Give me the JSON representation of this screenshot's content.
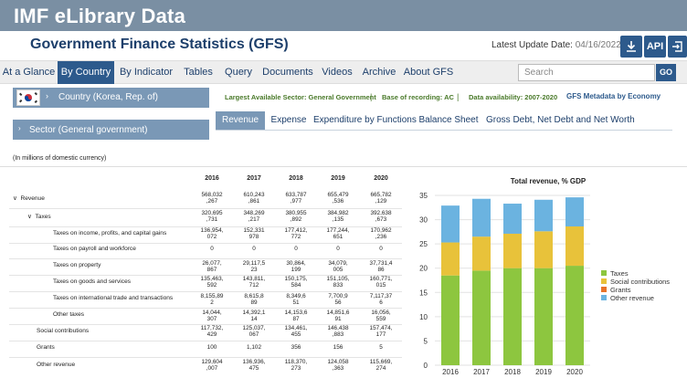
{
  "app": {
    "title": "IMF eLibrary Data"
  },
  "header": {
    "page_title": "Government Finance Statistics (GFS)",
    "update_label": "Latest Update Date:",
    "update_date": "04/16/2022",
    "api_label": "API",
    "download_icon": "download-icon",
    "share_icon": "share-icon"
  },
  "nav": {
    "items": [
      "At a Glance",
      "By Country",
      "By Indicator",
      "Tables",
      "Query",
      "Documents",
      "Videos",
      "Archive",
      "About GFS"
    ],
    "active": "By Country",
    "search_placeholder": "Search",
    "go_label": "GO"
  },
  "country": {
    "label": "Country (Korea, Rep. of)",
    "flag_icon": "south-korea-flag-icon"
  },
  "info": {
    "largest_sector": "Largest Available Sector: General Government",
    "recording_basis": "Base of recording: AC",
    "availability": "Data availability: 2007-2020",
    "metadata_link": "GFS Metadata by Economy"
  },
  "sector": {
    "label": "Sector (General government)"
  },
  "subtabs": {
    "items": [
      "Revenue",
      "Expense",
      "Expenditure by Functions",
      "Balance Sheet",
      "Gross Debt, Net Debt and Net Worth"
    ],
    "active": "Revenue"
  },
  "units_note": "(In millions of domestic currency)",
  "table": {
    "years": [
      "2016",
      "2017",
      "2018",
      "2019",
      "2020"
    ],
    "rows": [
      {
        "label": "Revenue",
        "values": [
          [
            "568,032",
            ",267"
          ],
          [
            "610,243",
            ",861"
          ],
          [
            "633,787",
            ",977"
          ],
          [
            "655,479",
            ",536"
          ],
          [
            "665,782",
            ",129"
          ]
        ]
      },
      {
        "label": "Taxes",
        "values": [
          [
            "320,695",
            ",731"
          ],
          [
            "348,269",
            ",217"
          ],
          [
            "380,955",
            ",892"
          ],
          [
            "384,982",
            ",135"
          ],
          [
            "392,638",
            ",673"
          ]
        ]
      },
      {
        "label": "Taxes on income, profits, and capital gains",
        "values": [
          [
            "136,954,",
            "072"
          ],
          [
            "152,331",
            "978"
          ],
          [
            "177,412,",
            "772"
          ],
          [
            "177,244,",
            "651"
          ],
          [
            "170,962",
            ",236"
          ]
        ]
      },
      {
        "label": "Taxes on payroll and workforce",
        "values": [
          [
            "0",
            ""
          ],
          [
            "0",
            ""
          ],
          [
            "0",
            ""
          ],
          [
            "0",
            ""
          ],
          [
            "0",
            ""
          ]
        ]
      },
      {
        "label": "Taxes on property",
        "values": [
          [
            "26,077,",
            "867"
          ],
          [
            "29,117,5",
            "23"
          ],
          [
            "30,864,",
            "199"
          ],
          [
            "34,079,",
            "005"
          ],
          [
            "37,731,4",
            "86"
          ]
        ]
      },
      {
        "label": "Taxes on goods and services",
        "values": [
          [
            "135,463,",
            "592"
          ],
          [
            "143,811,",
            "712"
          ],
          [
            "150,175,",
            "584"
          ],
          [
            "151,105,",
            "833"
          ],
          [
            "160,771,",
            "015"
          ]
        ]
      },
      {
        "label": "Taxes on international trade and transactions",
        "values": [
          [
            "8,155,89",
            "2"
          ],
          [
            "8,615,8",
            "89"
          ],
          [
            "8,349,6",
            "51"
          ],
          [
            "7,700,9",
            "56"
          ],
          [
            "7,117,37",
            "6"
          ]
        ]
      },
      {
        "label": "Other taxes",
        "values": [
          [
            "14,044,",
            "307"
          ],
          [
            "14,392,1",
            "14"
          ],
          [
            "14,153,6",
            "87"
          ],
          [
            "14,851,6",
            "91"
          ],
          [
            "16,056,",
            "559"
          ]
        ]
      },
      {
        "label": "Social contributions",
        "values": [
          [
            "117,732,",
            "429"
          ],
          [
            "125,037,",
            "067"
          ],
          [
            "134,461,",
            "455"
          ],
          [
            "146,438",
            ",883"
          ],
          [
            "157,474,",
            "177"
          ]
        ]
      },
      {
        "label": "Grants",
        "values": [
          [
            "100",
            ""
          ],
          [
            "1,102",
            ""
          ],
          [
            "356",
            ""
          ],
          [
            "156",
            ""
          ],
          [
            "5",
            ""
          ]
        ]
      },
      {
        "label": "Other revenue",
        "values": [
          [
            "129,604",
            ",007"
          ],
          [
            "136,936,",
            "475"
          ],
          [
            "118,370,",
            "273"
          ],
          [
            "124,058",
            ",363"
          ],
          [
            "115,669,",
            "274"
          ]
        ]
      }
    ]
  },
  "chart_data": {
    "type": "bar",
    "stacked": true,
    "title": "Total revenue, % GDP",
    "categories": [
      "2016",
      "2017",
      "2018",
      "2019",
      "2020"
    ],
    "ylim": [
      0,
      35
    ],
    "yticks": [
      0,
      5,
      10,
      15,
      20,
      25,
      30,
      35
    ],
    "grid": true,
    "legend_position": "right",
    "series": [
      {
        "name": "Taxes",
        "color": "#8dc63f",
        "values": [
          18.5,
          19.5,
          20.0,
          20.0,
          20.5
        ]
      },
      {
        "name": "Social contributions",
        "color": "#e8c23a",
        "values": [
          6.8,
          7.0,
          7.1,
          7.6,
          8.1
        ]
      },
      {
        "name": "Grants",
        "color": "#e8732a",
        "values": [
          0.0,
          0.0,
          0.0,
          0.0,
          0.0
        ]
      },
      {
        "name": "Other revenue",
        "color": "#6bb3e0",
        "values": [
          7.6,
          7.8,
          6.2,
          6.5,
          6.0
        ]
      }
    ]
  }
}
